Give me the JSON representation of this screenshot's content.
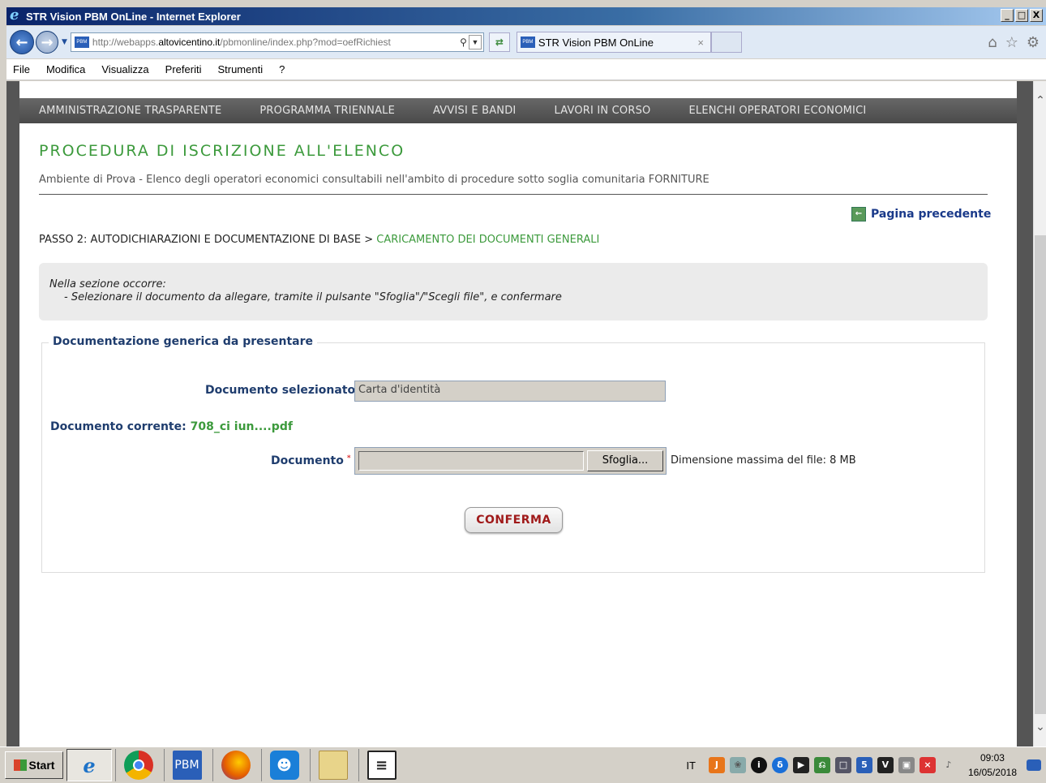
{
  "window": {
    "title": "STR Vision PBM OnLine - Internet Explorer",
    "min": "_",
    "max": "□",
    "close": "X"
  },
  "browser": {
    "url_prefix": "http://webapps.",
    "url_domain": "altovicentino.it",
    "url_path": "/pbmonline/index.php?mod=oefRichiest",
    "tab_title": "STR Vision PBM OnLine",
    "fav_label": "PBM",
    "icons": [
      "back-icon",
      "forward-icon",
      "search-icon",
      "refresh-icon",
      "home-icon",
      "star-icon",
      "gear-icon"
    ]
  },
  "menu": [
    "File",
    "Modifica",
    "Visualizza",
    "Preferiti",
    "Strumenti",
    "?"
  ],
  "topnav": [
    "AMMINISTRAZIONE TRASPARENTE",
    "PROGRAMMA TRIENNALE",
    "AVVISI E BANDI",
    "LAVORI IN CORSO",
    "ELENCHI OPERATORI ECONOMICI"
  ],
  "page": {
    "title": "PROCEDURA DI ISCRIZIONE ALL'ELENCO",
    "subtitle": "Ambiente di Prova - Elenco degli operatori economici consultabili nell'ambito di procedure sotto soglia comunitaria FORNITURE",
    "prev_link": "Pagina precedente",
    "step_prefix": "PASSO 2: AUTODICHIARAZIONI E DOCUMENTAZIONE DI BASE > ",
    "step_current": "CARICAMENTO DEI DOCUMENTI GENERALI",
    "note_line1": "Nella sezione occorre:",
    "note_line2": "- Selezionare il documento da allegare, tramite il pulsante \"Sfoglia\"/\"Scegli file\", e confermare",
    "fieldset_legend": "Documentazione generica da presentare",
    "doc_selected_label": "Documento selezionato",
    "doc_selected_value": "Carta d'identità",
    "doc_current_label": "Documento corrente:",
    "doc_current_value": "708_ci iun....pdf",
    "doc_label": "Documento",
    "required_mark": "*",
    "browse_label": "Sfoglia...",
    "max_size": "Dimensione massima del file: 8 MB",
    "confirm_label": "CONFERMA"
  },
  "taskbar": {
    "start": "Start",
    "lang": "IT",
    "time": "09:03",
    "date": "16/05/2018"
  },
  "colors": {
    "green": "#3c9a3c",
    "navy": "#1f3d6e",
    "confirm": "#a01a1a",
    "nav_bg": "#4a4a4a"
  }
}
